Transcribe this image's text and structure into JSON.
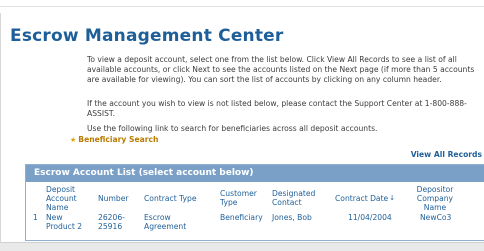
{
  "page": {
    "title": "Escrow Management Center",
    "intro": "To view a deposit account, select one from the list below.  Click View All Records to see a list of all available accounts, or click Next to see the accounts listed on the Next page (if more than 5 accounts are available for viewing).  You can sort the list of accounts by clicking on any column header.",
    "support": "If the account you wish to view is not listed below, please contact the Support Center at 1-800-888-ASSIST.",
    "search_hint": "Use the following link to search for beneficiaries across all deposit accounts.",
    "beneficiary_search": "Beneficiary Search",
    "view_all": "View All Records"
  },
  "table": {
    "title": "Escrow Account List (select account below)",
    "columns": [
      {
        "label": "Deposit Account Name"
      },
      {
        "label": "Number"
      },
      {
        "label": "Contract Type"
      },
      {
        "label": "Customer Type"
      },
      {
        "label": "Designated Contact"
      },
      {
        "label": "Contract Date"
      },
      {
        "label": "Depositor Company Name"
      }
    ],
    "sort_indicator": "↓",
    "rows": [
      {
        "index": "1",
        "name": "New Product 2",
        "number": "26206-25916",
        "contract_type": "Escrow Agreement",
        "customer_type": "Beneficiary",
        "contact": "Jones, Bob",
        "date": "11/04/2004",
        "company": "NewCo3"
      }
    ]
  },
  "icons": {
    "beneficiary_search_icon": "star-icon"
  },
  "colors": {
    "title": "#1f5f99",
    "header_bar": "#7aa0c8",
    "link_orange": "#b97a00"
  }
}
